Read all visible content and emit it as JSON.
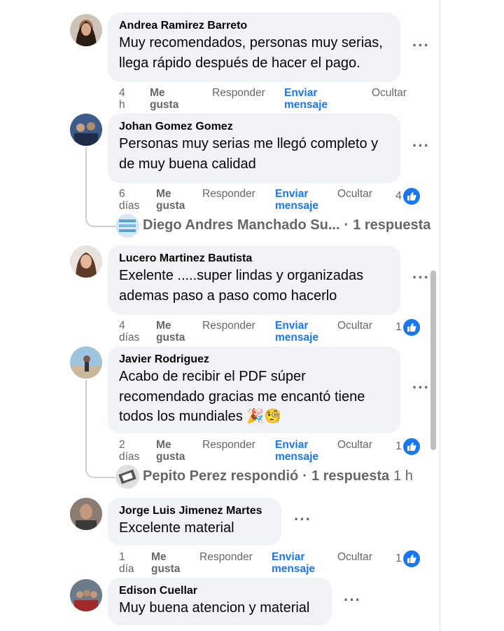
{
  "comments": [
    {
      "author": "Andrea Ramirez Barreto",
      "text": [
        "Muy recomendados, personas muy serias,",
        "llega rápido después de hacer el pago."
      ],
      "time": [
        "4",
        "h"
      ],
      "like": [
        "Me",
        "gusta"
      ],
      "reply": "Responder",
      "message": [
        "Enviar",
        "mensaje"
      ],
      "hide": "Ocultar"
    },
    {
      "author": "Johan Gomez Gomez",
      "text": [
        "Personas muy serias me llegó completo y",
        "de muy buena calidad"
      ],
      "time": [
        "6",
        "días"
      ],
      "like": [
        "Me",
        "gusta"
      ],
      "reply": "Responder",
      "message": [
        "Enviar",
        "mensaje"
      ],
      "hide": "Ocultar",
      "reactions": "4",
      "replies": {
        "name": "Diego Andres Manchado Su...",
        "sep": "·",
        "count": "1 respuesta"
      }
    },
    {
      "author": "Lucero Martinez Bautista",
      "text": [
        "Exelente .....super lindas y organizadas",
        "ademas paso a paso como hacerlo"
      ],
      "time": [
        "4",
        "días"
      ],
      "like": [
        "Me",
        "gusta"
      ],
      "reply": "Responder",
      "message": [
        "Enviar",
        "mensaje"
      ],
      "hide": "Ocultar",
      "reactions": "1"
    },
    {
      "author": "Javier Rodriguez",
      "text": [
        "Acabo de recibir el PDF súper",
        "recomendado gracias me encantó tiene",
        "todos los mundiales 🎉🧐"
      ],
      "time": [
        "2",
        "días"
      ],
      "like": [
        "Me",
        "gusta"
      ],
      "reply": "Responder",
      "message": [
        "Enviar",
        "mensaje"
      ],
      "hide": "Ocultar",
      "reactions": "1",
      "replies": {
        "name": "Pepito Perez respondió",
        "sep": "·",
        "count": "1 respuesta",
        "time": "1 h"
      }
    },
    {
      "author": "Jorge Luis Jimenez Martes",
      "text": [
        "Excelente material"
      ],
      "time": [
        "1",
        "día"
      ],
      "like": [
        "Me",
        "gusta"
      ],
      "reply": "Responder",
      "message": [
        "Enviar",
        "mensaje"
      ],
      "hide": "Ocultar",
      "reactions": "1"
    },
    {
      "author": "Edison Cuellar",
      "text": [
        "Muy buena atencion y material"
      ]
    }
  ],
  "more_icon": "···",
  "colors": {
    "accent": "#1877f2",
    "bubble": "#f0f2f5",
    "muted": "#65676b"
  }
}
